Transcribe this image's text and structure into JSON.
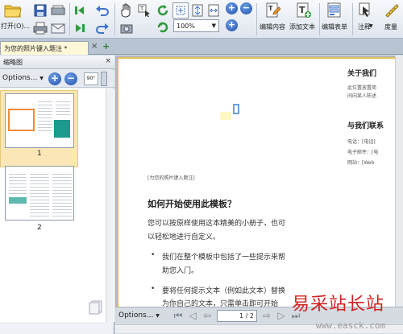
{
  "toolbar": {
    "open_label": "打开(O)...",
    "zoom_value": "100%",
    "edit_content_label": "编辑内容",
    "add_text_label": "添加文本",
    "edit_form_label": "编辑表单",
    "comment_label": "注释",
    "measure_label": "度量"
  },
  "tab": {
    "title": "为您的照片键入题注 *",
    "close": "×",
    "add": "+"
  },
  "panel": {
    "title": "缩略图",
    "close": "×",
    "options_label": "Options...",
    "zoom_in": "+",
    "zoom_out": "−",
    "rotate_label": "90°",
    "page1_num": "1",
    "page2_num": "2"
  },
  "document": {
    "caption": "[为您的照片键入题注]",
    "heading": "如何开始使用此模板？",
    "para_line1": "您可以按原样使用这本精美的小册子，也可",
    "para_line2": "以轻松地进行自定义。",
    "bullet1_line1": "我们在整个模板中包括了一些提示来帮",
    "bullet1_line2": "助您入门。",
    "bullet2_line1": "要将任何提示文本（例如此文本）替换",
    "bullet2_line2": "为你自己的文本，只需单击即可开始",
    "bullet_symbol": "•",
    "about_heading": "关于我们",
    "about_line1": "此位置放置简",
    "about_line2": "间向某人陈述",
    "contact_heading": "与我们联系",
    "phone": "电话：[电话]",
    "email": "电子邮件：[电",
    "website": "网站：[Web"
  },
  "bottom": {
    "options_label": "Options...",
    "page_value": "1 / 2"
  },
  "watermark": {
    "text": "易采站长站",
    "url": "www.easck.com"
  },
  "colors": {
    "accent_yellow": "#e0bf56",
    "thumb_orange": "#f08a3c",
    "thumb_teal": "#1a9b8e",
    "round_blue": "#1f4fa8"
  }
}
